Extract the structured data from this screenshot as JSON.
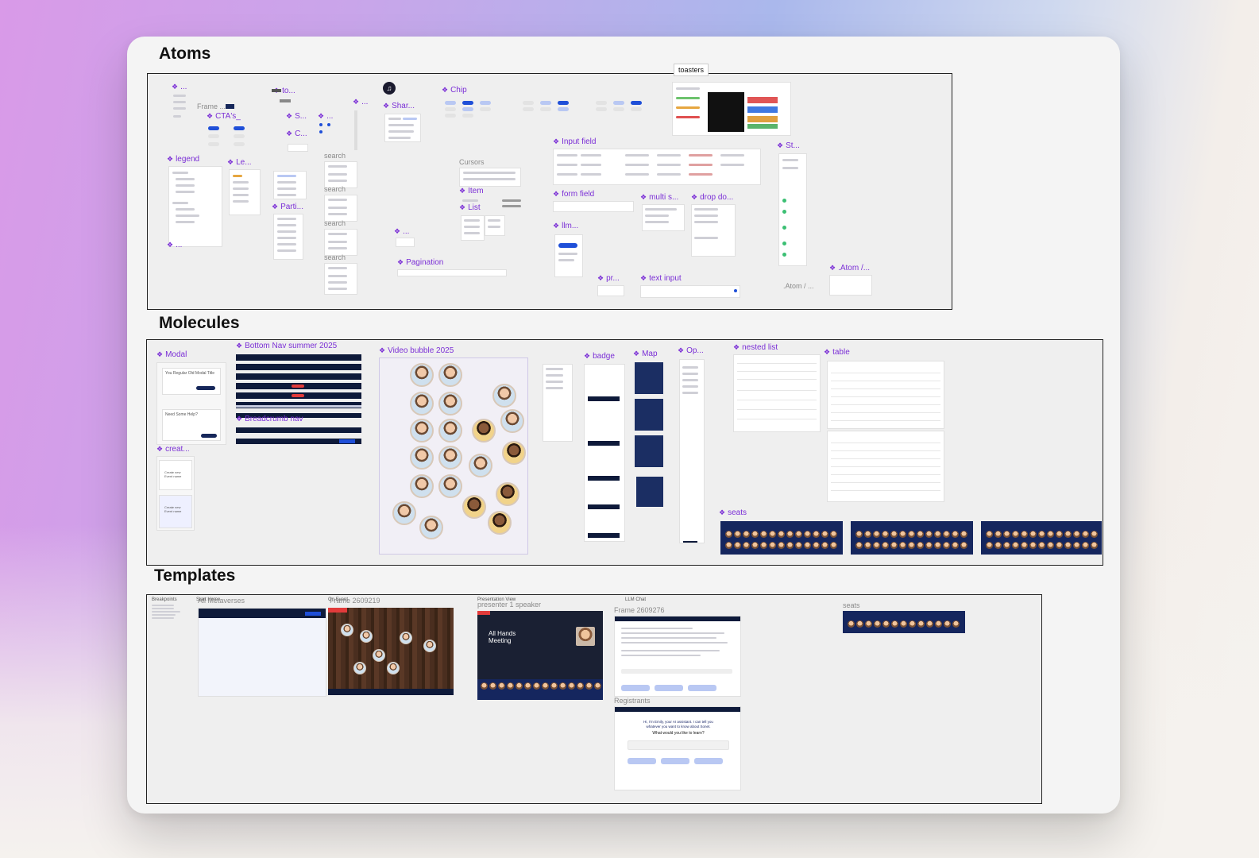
{
  "sections": {
    "atoms": "Atoms",
    "molecules": "Molecules",
    "templates": "Templates"
  },
  "atoms": {
    "toasters_tag": "toasters",
    "components": {
      "dots1": "...",
      "to": "to...",
      "frame": "Frame ...",
      "ctas": "CTA's_",
      "s": "S...",
      "c": "C...",
      "dots2": "...",
      "dots3": "...",
      "share": "Shar...",
      "chip": "Chip",
      "legend": "legend",
      "le": "Le...",
      "parti": "Parti...",
      "search1": "search",
      "search2": "search",
      "search3": "search",
      "search4": "search",
      "cursors": "Cursors",
      "item": "Item",
      "list": "List",
      "dots4": "...",
      "pagination": "Pagination",
      "dots5": "...",
      "input_field": "Input field",
      "form_field": "form field",
      "multi_s": "multi s...",
      "drop_do": "drop do...",
      "llm": "llm...",
      "pr": "pr...",
      "text_input": "text input",
      "st": "St...",
      "atom_ghost": ".Atom / ...",
      "atom": ".Atom /..."
    }
  },
  "molecules": {
    "modal": "Modal",
    "bottom_nav": "Bottom Nav summer 2025",
    "breadcrumb_nav": "Breadcrumb nav",
    "creat": "creat...",
    "video_bubble": "Video bubble 2025",
    "badge": "badge",
    "map": "Map",
    "op": "Op...",
    "nested_list": "nested list",
    "table": "table",
    "seats": "seats",
    "modal_card1_title": "You Regular Old Modal Title",
    "modal_card2_title": "Need Some Help?",
    "create_card1": "Create new Event name",
    "create_card2": "Create new Event name"
  },
  "templates": {
    "breakpoints": "Breakpoints",
    "start_home": "Start Home",
    "all_metaverses": "All Metaverses",
    "frame_2609219_top": "On Event",
    "frame_2609219": "Frame 2609219",
    "presentation_view": "Presentation View",
    "presenter_1_speaker": "presenter 1 speaker",
    "llm_chat": "LLM Chat",
    "frame_2609276": "Frame 2609276",
    "registrants": "Registrants",
    "seats": "seats",
    "all_hands": "All Hands Meeting",
    "emily_greeting": "Hi, I'm Emily, your AI assistant. I can tell you whatever you want to know about Sonet.",
    "emily_question": "What would you like to learn?"
  }
}
